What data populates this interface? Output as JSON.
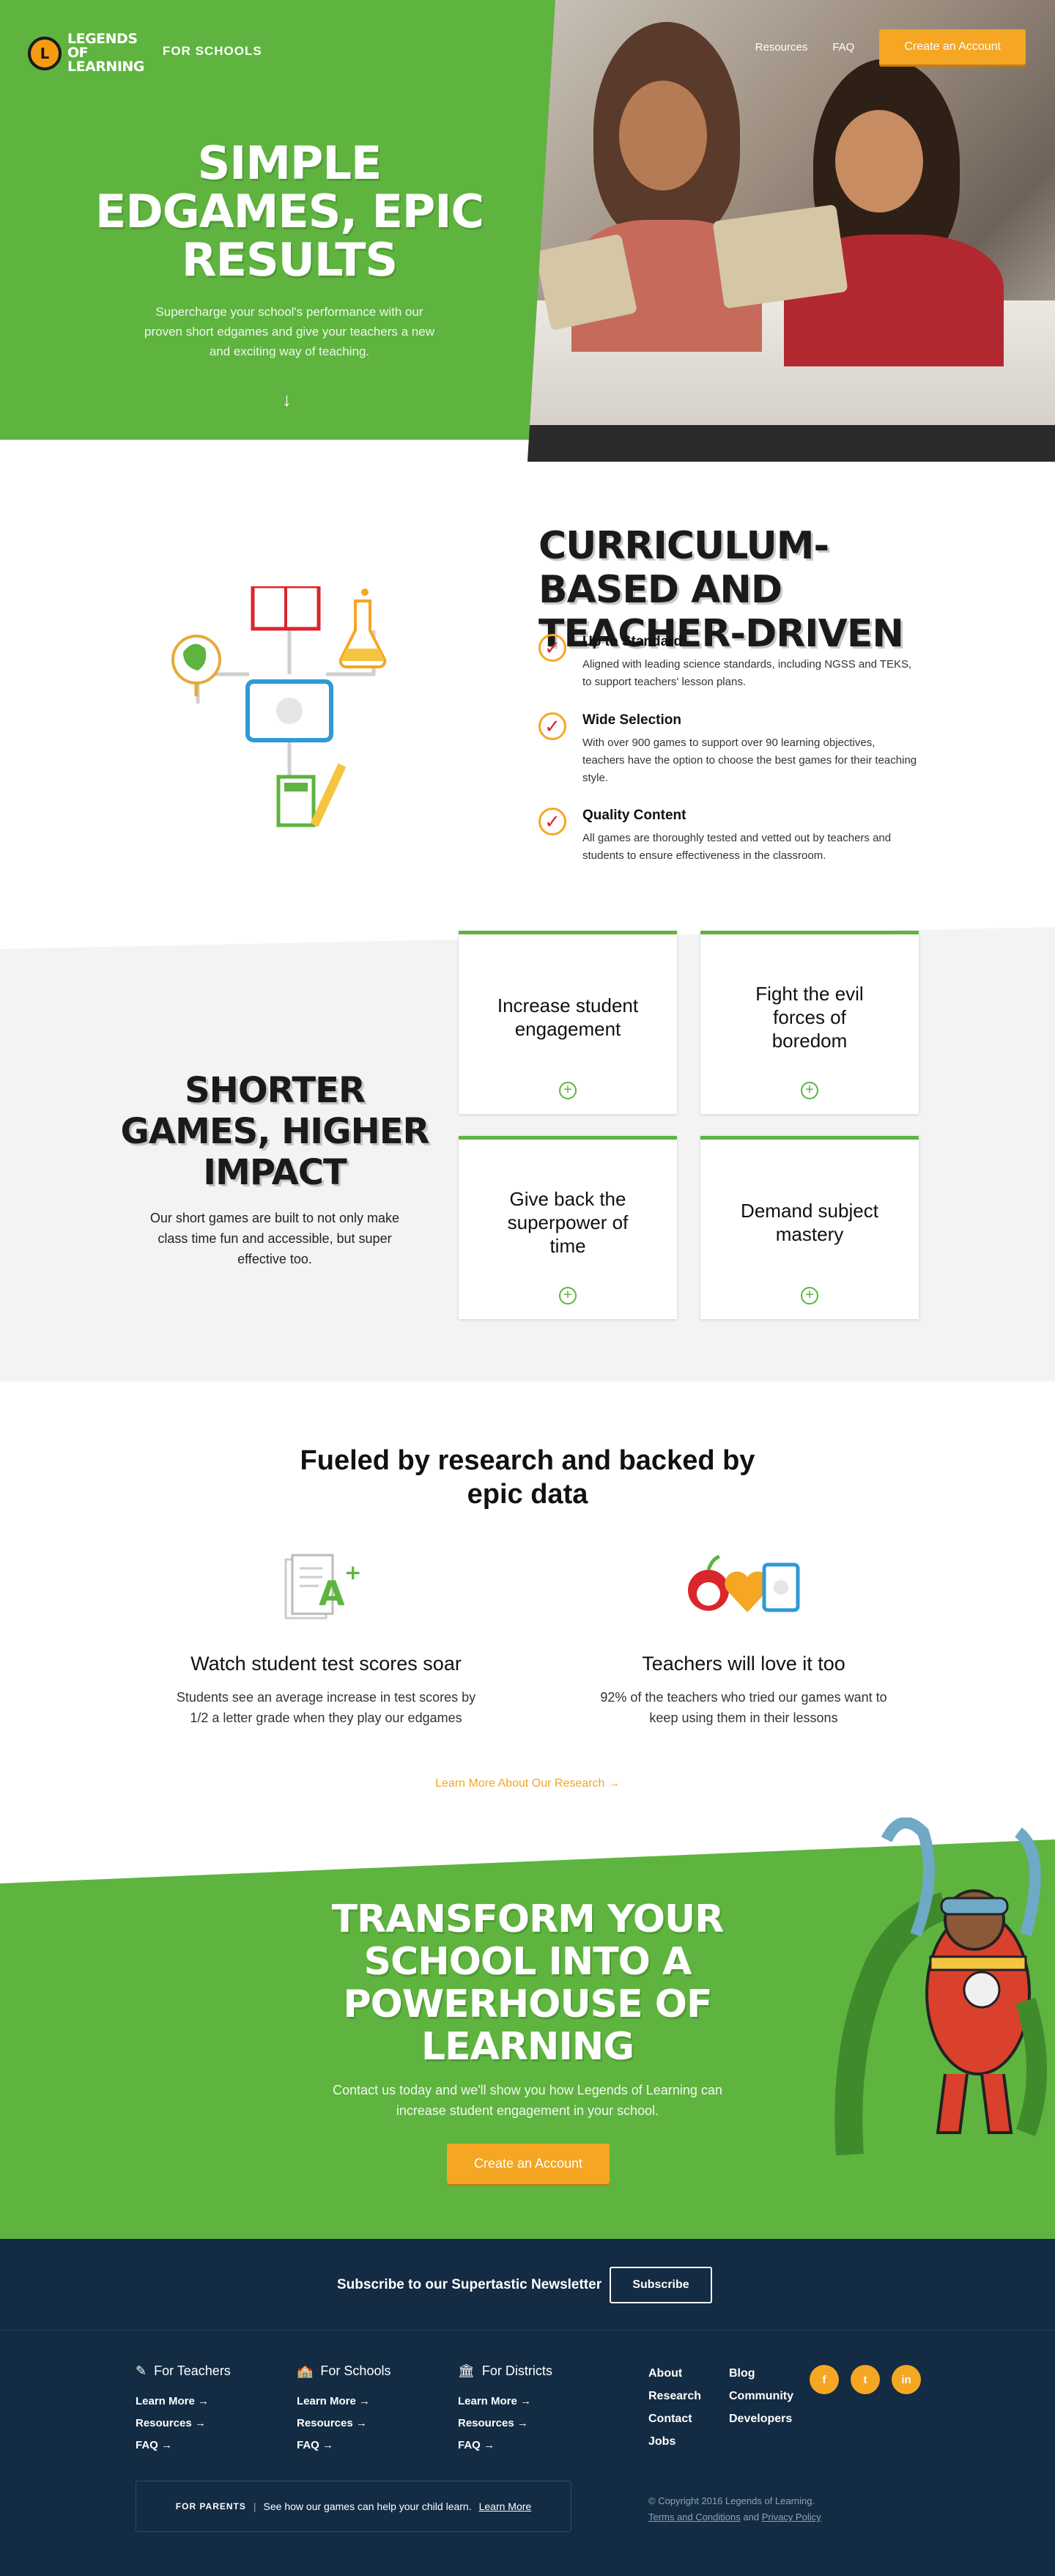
{
  "header": {
    "logo_text": "LEGENDS OF LEARNING",
    "section_label": "FOR SCHOOLS",
    "nav": {
      "resources": "Resources",
      "faq": "FAQ",
      "cta": "Create an Account"
    }
  },
  "hero": {
    "title": "SIMPLE EDGAMES, EPIC RESULTS",
    "subtitle": "Supercharge your school's performance with our proven short edgames and give your teachers a new and exciting way of teaching."
  },
  "curriculum": {
    "title": "CURRICULUM-BASED AND TEACHER-DRIVEN",
    "features": [
      {
        "title": "Up to Standard",
        "text": "Aligned with leading science standards, including NGSS and TEKS, to support teachers' lesson plans."
      },
      {
        "title": "Wide Selection",
        "text": "With over 900 games to support over 90 learning objectives, teachers have the option to choose the best games for their teaching style."
      },
      {
        "title": "Quality Content",
        "text": "All games are thoroughly tested and vetted out by teachers and students to ensure effectiveness in the classroom."
      }
    ]
  },
  "shorter": {
    "title": "SHORTER GAMES, HIGHER IMPACT",
    "subtitle": "Our short games are built to not only make class time fun and accessible, but super effective too.",
    "cards": [
      "Increase student engagement",
      "Fight the evil forces of boredom",
      "Give back the superpower of time",
      "Demand subject mastery"
    ]
  },
  "research": {
    "title": "Fueled by research and backed by epic data",
    "stats": [
      {
        "title": "Watch student test scores soar",
        "text": "Students see an average increase in test scores by 1/2 a letter grade when they play our edgames"
      },
      {
        "title": "Teachers will love it too",
        "text": "92% of the teachers who tried our games want to keep using them in their lessons"
      }
    ],
    "link": "Learn More About Our Research →"
  },
  "cta": {
    "title": "TRANSFORM YOUR SCHOOL INTO A POWERHOUSE OF LEARNING",
    "subtitle": "Contact us today and we'll show you how Legends of Learning can increase student engagement in your school.",
    "button": "Create an Account"
  },
  "footer": {
    "newsletter_text": "Subscribe to our Supertastic Newsletter",
    "subscribe": "Subscribe",
    "columns": [
      {
        "title": "For Teachers",
        "links": [
          "Learn More →",
          "Resources →",
          "FAQ →"
        ]
      },
      {
        "title": "For Schools",
        "links": [
          "Learn More →",
          "Resources →",
          "FAQ →"
        ]
      },
      {
        "title": "For Districts",
        "links": [
          "Learn More →",
          "Resources →",
          "FAQ →"
        ]
      }
    ],
    "links_a": [
      "About",
      "Research",
      "Contact",
      "Jobs"
    ],
    "links_b": [
      "Blog",
      "Community",
      "Developers"
    ],
    "social": [
      "f",
      "t",
      "in"
    ],
    "parents_label": "FOR PARENTS",
    "parents_text": "See how our games can help your child learn.",
    "parents_link": "Learn More",
    "copyright": "© Copyright 2016 Legends of Learning.",
    "terms": "Terms and Conditions",
    "and": "and",
    "privacy": "Privacy Policy"
  },
  "colors": {
    "green": "#5eb43f",
    "orange": "#f5a623",
    "navy": "#132b43"
  }
}
